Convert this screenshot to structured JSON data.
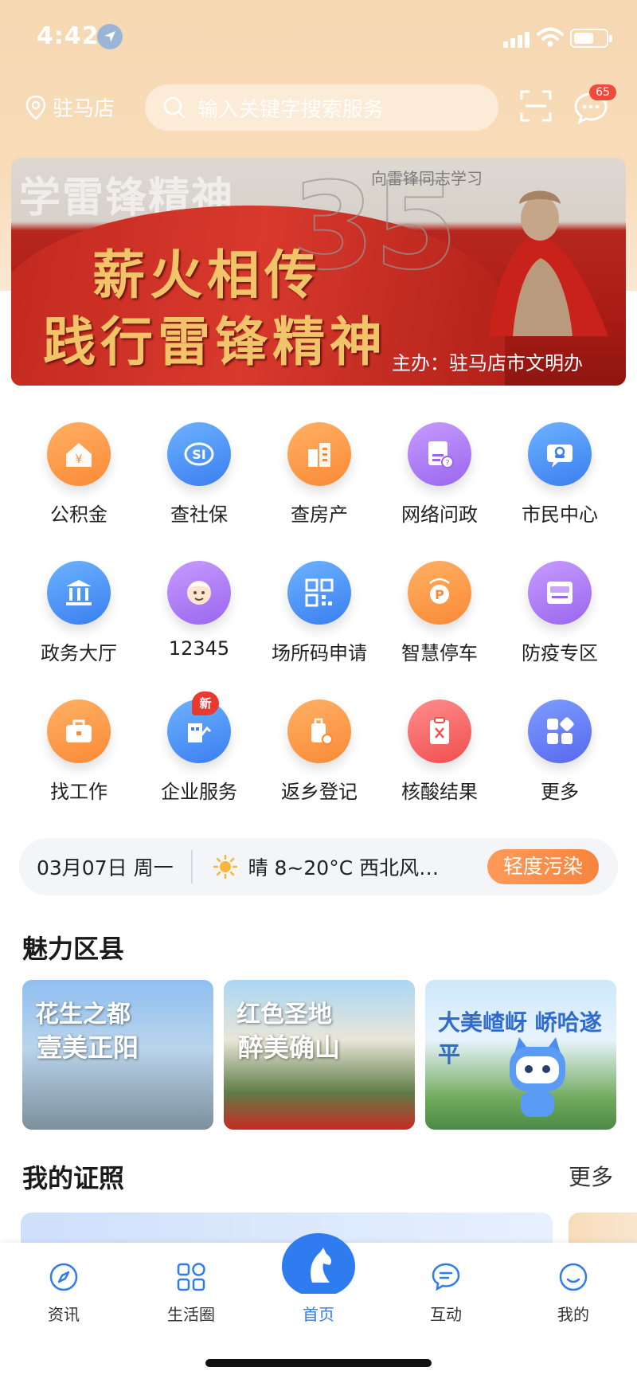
{
  "status": {
    "time": "4:42"
  },
  "header": {
    "city": "驻马店",
    "search_placeholder": "输入关键字搜索服务",
    "message_badge": "65"
  },
  "banner": {
    "background_text": "学雷锋精神",
    "subtitle": "向雷锋同志学习",
    "number": "35",
    "line1": "薪火相传",
    "line2": "践行雷锋精神",
    "host": "主办：驻马店市文明办"
  },
  "services": [
    {
      "label": "公积金",
      "icon": "housing-fund-icon",
      "color": "orange"
    },
    {
      "label": "查社保",
      "icon": "social-security-icon",
      "color": "blue"
    },
    {
      "label": "查房产",
      "icon": "property-icon",
      "color": "orange"
    },
    {
      "label": "网络问政",
      "icon": "online-inquiry-icon",
      "color": "purple"
    },
    {
      "label": "市民中心",
      "icon": "citizen-center-icon",
      "color": "blue"
    },
    {
      "label": "政务大厅",
      "icon": "government-hall-icon",
      "color": "blue"
    },
    {
      "label": "12345",
      "icon": "hotline-icon",
      "color": "purple"
    },
    {
      "label": "场所码申请",
      "icon": "qr-code-icon",
      "color": "blue"
    },
    {
      "label": "智慧停车",
      "icon": "parking-icon",
      "color": "orange"
    },
    {
      "label": "防疫专区",
      "icon": "epidemic-icon",
      "color": "purple"
    },
    {
      "label": "找工作",
      "icon": "briefcase-icon",
      "color": "orange"
    },
    {
      "label": "企业服务",
      "icon": "enterprise-icon",
      "color": "blue",
      "badge": "新"
    },
    {
      "label": "返乡登记",
      "icon": "luggage-icon",
      "color": "orange"
    },
    {
      "label": "核酸结果",
      "icon": "nucleic-test-icon",
      "color": "red"
    },
    {
      "label": "更多",
      "icon": "more-grid-icon",
      "color": "blue"
    }
  ],
  "weather": {
    "date": "03月07日 周一",
    "condition": "晴  8~20°C  西北风…",
    "air_quality": "轻度污染"
  },
  "counties": {
    "title": "魅力区县",
    "items": [
      {
        "line1": "花生之都",
        "line2": "壹美正阳"
      },
      {
        "line1": "红色圣地",
        "line2": "醉美确山"
      },
      {
        "line1": "大美嵖岈 峤哈遂平",
        "line2": ""
      }
    ]
  },
  "certificates": {
    "title": "我的证照",
    "more": "更多"
  },
  "tabbar": {
    "items": [
      {
        "label": "资讯",
        "icon": "compass-icon"
      },
      {
        "label": "生活圈",
        "icon": "apps-icon"
      },
      {
        "label": "首页",
        "icon": "home-horse-icon"
      },
      {
        "label": "互动",
        "icon": "chat-icon"
      },
      {
        "label": "我的",
        "icon": "profile-icon"
      }
    ]
  }
}
